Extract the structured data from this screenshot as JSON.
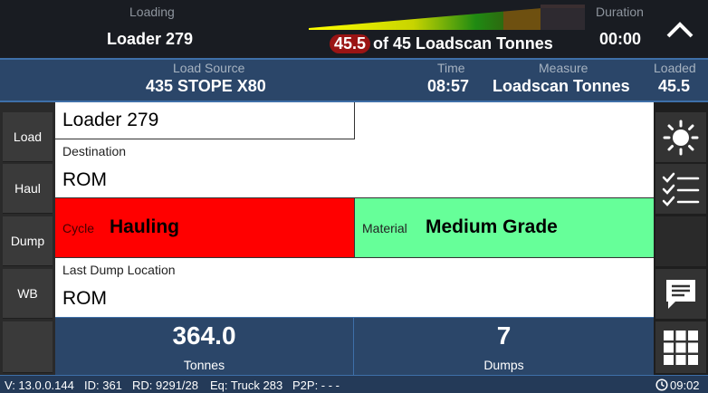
{
  "header": {
    "loading_label": "Loading",
    "loader_value": "Loader 279",
    "progress_current": "45.5",
    "progress_suffix": "of 45 Loadscan Tonnes",
    "duration_label": "Duration",
    "duration_value": "00:00",
    "collapse_icon": "chevron-up-icon",
    "gauge_fill_fraction": 0.84
  },
  "info_bar": {
    "load_source_label": "Load Source",
    "load_source_value": "435 STOPE X80",
    "time_label": "Time",
    "time_value": "08:57",
    "measure_label": "Measure",
    "measure_value": "Loadscan Tonnes",
    "loaded_label": "Loaded",
    "loaded_value": "45.5"
  },
  "tabs": [
    {
      "label": "Load"
    },
    {
      "label": "Haul"
    },
    {
      "label": "Dump"
    },
    {
      "label": "WB"
    }
  ],
  "main": {
    "loader": "Loader 279",
    "destination_label": "Destination",
    "destination_value": "ROM",
    "cycle_label": "Cycle",
    "cycle_value": "Hauling",
    "material_label": "Material",
    "material_value": "Medium Grade",
    "last_dump_label": "Last Dump Location",
    "last_dump_value": "ROM"
  },
  "stats": {
    "tonnes_value": "364.0",
    "tonnes_label": "Tonnes",
    "dumps_value": "7",
    "dumps_label": "Dumps"
  },
  "right_buttons": [
    {
      "icon": "brightness-icon"
    },
    {
      "icon": "checklist-icon"
    },
    {
      "icon": "blank"
    },
    {
      "icon": "chat-icon"
    },
    {
      "icon": "grid-menu-icon"
    }
  ],
  "status_bar": {
    "version": "V: 13.0.0.144",
    "id": "ID: 361",
    "rd": "RD: 9291/28",
    "eq": "Eq: Truck 283",
    "p2p": "P2P: - - -",
    "clock": "09:02"
  },
  "colors": {
    "cycle_bg": "#ff0000",
    "material_bg": "#66ff99",
    "progress_pill": "#9a1414",
    "info_bg": "#2b4669"
  }
}
